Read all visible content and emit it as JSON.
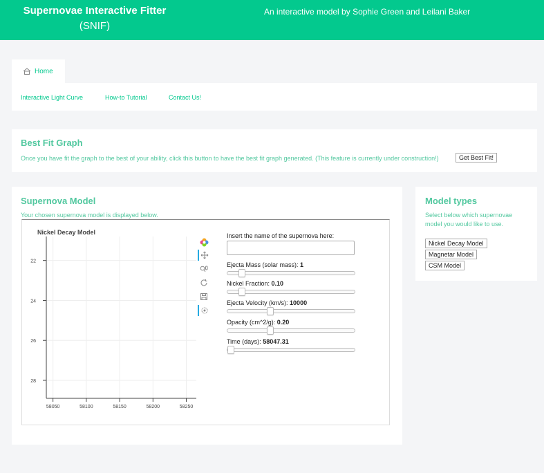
{
  "header": {
    "title": "Supernovae Interactive Fitter",
    "title_abbr": "(SNIF)",
    "tagline": "An interactive model by Sophie Green and Leilani Baker"
  },
  "tabs": {
    "home": "Home",
    "home_icon": "home-icon"
  },
  "nav": {
    "items": [
      "Interactive Light Curve",
      "How-to Tutorial",
      "Contact Us!"
    ]
  },
  "best_fit": {
    "title": "Best Fit Graph",
    "description": "Once you have fit the graph to the best of your ability, click this button to have the best fit graph generated. (This feature is currently under construction!)",
    "button": "Get Best Fit!"
  },
  "model": {
    "title": "Supernova Model",
    "subtitle": "Your chosen supernova model is displayed below.",
    "name_prompt": "Insert the name of the supernova here:",
    "name_value": "",
    "sliders": [
      {
        "label": "Ejecta Mass (solar mass):",
        "value": "1",
        "fraction": 0.09
      },
      {
        "label": "Nickel Fraction:",
        "value": "0.10",
        "fraction": 0.09
      },
      {
        "label": "Ejecta Velocity (km/s):",
        "value": "10000",
        "fraction": 0.33
      },
      {
        "label": "Opacity (cm^2/g):",
        "value": "0.20",
        "fraction": 0.33
      },
      {
        "label": "Time (days):",
        "value": "58047.31",
        "fraction": 0.0
      }
    ]
  },
  "types": {
    "title": "Model types",
    "description": "Select below which supernovae model you would like to use.",
    "buttons": [
      "Nickel Decay Model",
      "Magnetar Model",
      "CSM Model"
    ]
  },
  "chart_data": {
    "type": "scatter",
    "title": "Nickel Decay Model",
    "xlabel": "",
    "ylabel": "",
    "x_ticks": [
      58050,
      58100,
      58150,
      58200,
      58250
    ],
    "y_ticks": [
      22,
      24,
      26,
      28
    ],
    "xlim": [
      58040,
      58265
    ],
    "ylim": [
      28.9,
      20.8
    ],
    "y_inverted": true,
    "grid": true,
    "series": []
  },
  "toolbar": {
    "tools": [
      "bokeh-logo-icon",
      "pan-icon",
      "wheel-zoom-icon",
      "reset-icon",
      "save-icon",
      "hover-icon"
    ]
  }
}
